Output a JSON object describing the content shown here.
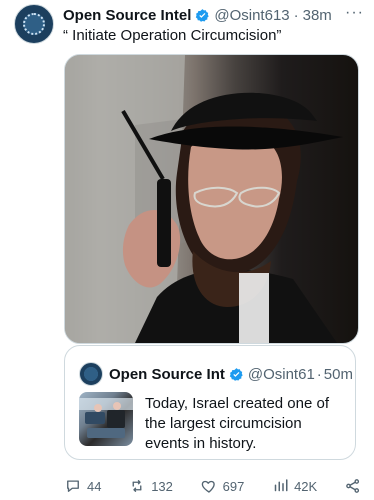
{
  "tweet": {
    "author": "Open Source Intel",
    "handle": "@Osint613",
    "separator": "·",
    "time": "38m",
    "more": "···",
    "text": "“ Initiate Operation Circumcision”"
  },
  "quoted": {
    "author": "Open Source Int",
    "handle": "@Osint61",
    "separator": "·",
    "time": "50m",
    "text": "Today, Israel created one of the largest circumcision events in history."
  },
  "actions": {
    "replies": "44",
    "reposts": "132",
    "likes": "697",
    "views": "42K"
  },
  "icons": {
    "verified": "verified-badge-icon",
    "reply": "reply-icon",
    "repost": "repost-icon",
    "like": "heart-icon",
    "views": "views-icon",
    "share": "share-icon"
  },
  "colors": {
    "accent": "#1d9bf0",
    "muted": "#536471"
  }
}
